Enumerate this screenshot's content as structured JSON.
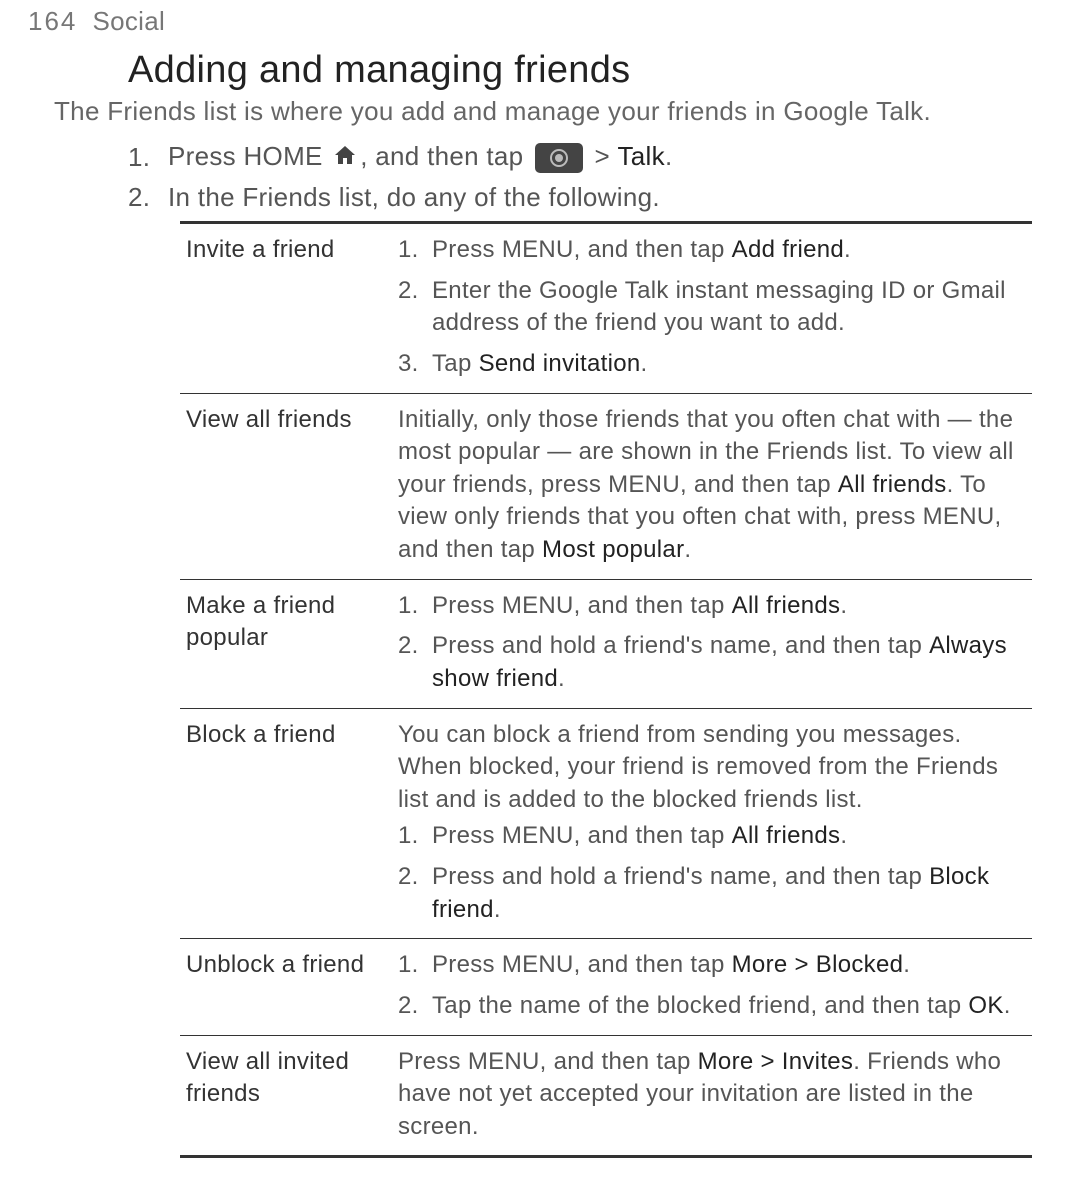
{
  "runhead": {
    "page": "164",
    "section": "Social"
  },
  "title": "Adding and managing friends",
  "intro": "The Friends list is where you add and manage your friends in Google Talk.",
  "step1_a": "Press HOME ",
  "step1_b": ", and then tap ",
  "step1_c": " > ",
  "step1_talk": "Talk",
  "step1_d": ".",
  "step2": "In the Friends list, do any of the following.",
  "rows": {
    "invite": {
      "label": "Invite a friend",
      "s1a": "Press MENU, and then tap ",
      "s1b": "Add friend",
      "s1c": ".",
      "s2": "Enter the Google Talk instant messaging ID or Gmail address of the friend you want to add.",
      "s3a": "Tap ",
      "s3b": "Send invitation",
      "s3c": "."
    },
    "viewall": {
      "label": "View all friends",
      "ta": "Initially, only those friends that you often chat with — the most popular — are shown in the Friends list. To view all your friends, press MENU, and then tap ",
      "tb": "All friends",
      "tc": ". To view only friends that you often chat with, press MENU, and then tap ",
      "td": "Most popular",
      "te": "."
    },
    "popular": {
      "label": "Make a friend popular",
      "s1a": "Press MENU, and then tap ",
      "s1b": "All friends",
      "s1c": ".",
      "s2a": "Press and hold a friend's name, and then tap ",
      "s2b": "Always show friend",
      "s2c": "."
    },
    "block": {
      "label": "Block a friend",
      "pre": "You can block a friend from sending you messages. When blocked, your friend is removed from the Friends list and is added to the blocked friends list.",
      "s1a": "Press MENU, and then tap ",
      "s1b": "All friends",
      "s1c": ".",
      "s2a": "Press and hold a friend's name, and then tap ",
      "s2b": "Block friend",
      "s2c": "."
    },
    "unblock": {
      "label": "Unblock a friend",
      "s1a": "Press MENU, and then tap ",
      "s1b": "More > Blocked",
      "s1c": ".",
      "s2a": "Tap the name of the blocked friend, and then tap ",
      "s2b": "OK",
      "s2c": "."
    },
    "invites": {
      "label": "View all invited friends",
      "ta": "Press MENU, and then tap ",
      "tb": "More > Invites",
      "tc": ". Friends who have not yet accepted your invitation are listed in the screen."
    }
  }
}
